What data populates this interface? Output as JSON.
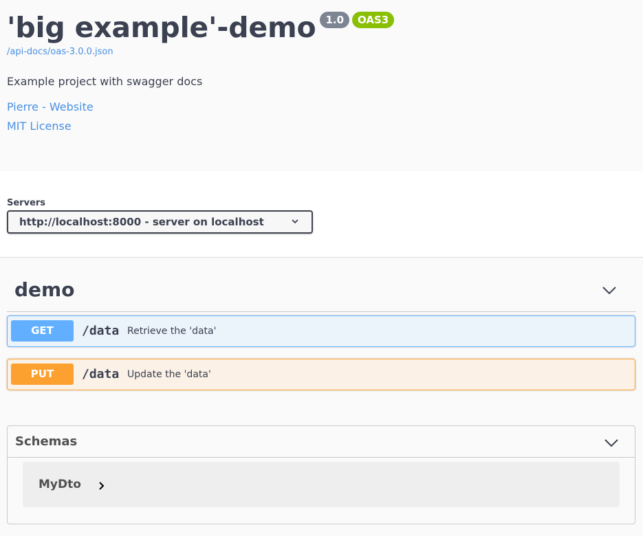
{
  "info": {
    "title": "'big example'-demo",
    "version_badge": "1.0",
    "oas_badge": "OAS3",
    "spec_link": "/api-docs/oas-3.0.0.json",
    "description": "Example project with swagger docs",
    "contact_link": "Pierre - Website",
    "license_link": "MIT License"
  },
  "servers": {
    "label": "Servers",
    "selected": "http://localhost:8000 - server on localhost"
  },
  "tag": {
    "name": "demo"
  },
  "operations": [
    {
      "method": "GET",
      "path": "/data",
      "summary": "Retrieve the 'data'"
    },
    {
      "method": "PUT",
      "path": "/data",
      "summary": "Update the 'data'"
    }
  ],
  "schemas": {
    "title": "Schemas",
    "models": [
      {
        "name": "MyDto"
      }
    ]
  },
  "colors": {
    "get": "#61affe",
    "put": "#fca130",
    "link": "#4990e2",
    "version_badge": "#7d8492",
    "oas_badge": "#89bf04"
  },
  "icons": {
    "server_dropdown": "chevron-down-icon",
    "tag_toggle": "chevron-down-icon",
    "schemas_toggle": "chevron-down-icon",
    "model_expand": "chevron-right-icon"
  }
}
